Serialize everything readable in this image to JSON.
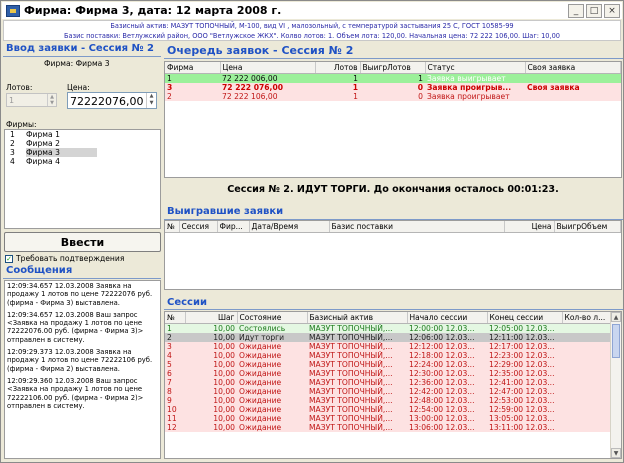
{
  "window": {
    "title": "Фирма: Фирма 3, дата: 12 марта 2008 г.",
    "minimize": "_",
    "maximize": "□",
    "close": "×"
  },
  "info": {
    "line1": "Базисный актив: МАЗУТ ТОПОЧНЫЙ, М-100, вид VI , малозольный, с температурой застывания 25 С, ГОСТ 10585-99",
    "line2": "Базис поставки: Ветлужский район, ООО \"Ветлужское ЖКХ\". Колво лотов: 1. Объем лота: 120,00. Начальная цена: 72 222 106,00. Шаг: 10,00"
  },
  "order_entry": {
    "header": "Ввод заявки - Сессия № 2",
    "firm": "Фирма: Фирма 3",
    "lots_label": "Лотов:",
    "lots_value": "1",
    "price_label": "Цена:",
    "price_value": "72222076,00",
    "firms_label": "Фирмы:",
    "firms": [
      {
        "n": "1",
        "name": "Фирма 1"
      },
      {
        "n": "2",
        "name": "Фирма 2"
      },
      {
        "n": "3",
        "name": "Фирма 3"
      },
      {
        "n": "4",
        "name": "Фирма 4"
      }
    ],
    "submit_label": "Ввести",
    "confirm_label": "Требовать подтверждения"
  },
  "messages": {
    "header": "Сообщения",
    "items": [
      "12:09:34.657 12.03.2008 Заявка на продажу 1 лотов по цене 72222076 руб. (фирма - Фирма 3) выставлена.",
      "12:09:34.657 12.03.2008 Ваш запрос <Заявка на продажу 1 лотов по цене 72222076.00 руб. (фирма - Фирма 3)> отправлен в систему.",
      "12:09:29.373 12.03.2008 Заявка на продажу 1 лотов по цене 72222106 руб. (фирма - Фирма 2) выставлена.",
      "12:09:29.360 12.03.2008 Ваш запрос <Заявка на продажу 1 лотов по цене 72222106.00 руб. (фирма - Фирма 2)> отправлен в систему."
    ]
  },
  "queue": {
    "header": "Очередь заявок - Сессия № 2",
    "columns": [
      "Фирма",
      "Цена",
      "Лотов",
      "ВыигрЛотов",
      "Статус",
      "Своя заявка"
    ],
    "rows": [
      {
        "firm": "1",
        "price": "72 222 006,00",
        "lots": "1",
        "won": "1",
        "status": "Заявка выигрывает",
        "own": ""
      },
      {
        "firm": "3",
        "price": "72 222 076,00",
        "lots": "1",
        "won": "0",
        "status": "Заявка проигрыв...",
        "own": "Своя заявка"
      },
      {
        "firm": "2",
        "price": "72 222 106,00",
        "lots": "1",
        "won": "0",
        "status": "Заявка проигрывает",
        "own": ""
      }
    ]
  },
  "session_status": "Сессия № 2. ИДУТ ТОРГИ. До окончания осталось 00:01:23.",
  "winners": {
    "header": "Выигравшие заявки",
    "columns": [
      "№",
      "Сессия",
      "Фир...",
      "Дата/Время",
      "Базис поставки",
      "Цена",
      "ВыигрОбъем"
    ]
  },
  "sessions": {
    "header": "Сессии",
    "columns": [
      "№",
      "Шаг",
      "Состояние",
      "Базисный актив",
      "Начало сессии",
      "Конец сессии",
      "Кол-во л..."
    ],
    "rows": [
      {
        "n": "1",
        "step": "10,00",
        "state": "Состоялись",
        "asset": "МАЗУТ ТОПОЧНЫЙ,...",
        "start": "12:00:00",
        "start2": "12.03...",
        "end": "12:05:00",
        "end2": "12.03..."
      },
      {
        "n": "2",
        "step": "10,00",
        "state": "Идут торги",
        "asset": "МАЗУТ ТОПОЧНЫЙ,...",
        "start": "12:06:00",
        "start2": "12.03...",
        "end": "12:11:00",
        "end2": "12.03..."
      },
      {
        "n": "3",
        "step": "10,00",
        "state": "Ожидание",
        "asset": "МАЗУТ ТОПОЧНЫЙ,...",
        "start": "12:12:00",
        "start2": "12.03...",
        "end": "12:17:00",
        "end2": "12.03..."
      },
      {
        "n": "4",
        "step": "10,00",
        "state": "Ожидание",
        "asset": "МАЗУТ ТОПОЧНЫЙ,...",
        "start": "12:18:00",
        "start2": "12.03...",
        "end": "12:23:00",
        "end2": "12.03..."
      },
      {
        "n": "5",
        "step": "10,00",
        "state": "Ожидание",
        "asset": "МАЗУТ ТОПОЧНЫЙ,...",
        "start": "12:24:00",
        "start2": "12.03...",
        "end": "12:29:00",
        "end2": "12.03..."
      },
      {
        "n": "6",
        "step": "10,00",
        "state": "Ожидание",
        "asset": "МАЗУТ ТОПОЧНЫЙ,...",
        "start": "12:30:00",
        "start2": "12.03...",
        "end": "12:35:00",
        "end2": "12.03..."
      },
      {
        "n": "7",
        "step": "10,00",
        "state": "Ожидание",
        "asset": "МАЗУТ ТОПОЧНЫЙ,...",
        "start": "12:36:00",
        "start2": "12.03...",
        "end": "12:41:00",
        "end2": "12.03..."
      },
      {
        "n": "8",
        "step": "10,00",
        "state": "Ожидание",
        "asset": "МАЗУТ ТОПОЧНЫЙ,...",
        "start": "12:42:00",
        "start2": "12.03...",
        "end": "12:47:00",
        "end2": "12.03..."
      },
      {
        "n": "9",
        "step": "10,00",
        "state": "Ожидание",
        "asset": "МАЗУТ ТОПОЧНЫЙ,...",
        "start": "12:48:00",
        "start2": "12.03...",
        "end": "12:53:00",
        "end2": "12.03..."
      },
      {
        "n": "10",
        "step": "10,00",
        "state": "Ожидание",
        "asset": "МАЗУТ ТОПОЧНЫЙ,...",
        "start": "12:54:00",
        "start2": "12.03...",
        "end": "12:59:00",
        "end2": "12.03..."
      },
      {
        "n": "11",
        "step": "10,00",
        "state": "Ожидание",
        "asset": "МАЗУТ ТОПОЧНЫЙ,...",
        "start": "13:00:00",
        "start2": "12.03...",
        "end": "13:05:00",
        "end2": "12.03..."
      },
      {
        "n": "12",
        "step": "10,00",
        "state": "Ожидание",
        "asset": "МАЗУТ ТОПОЧНЫЙ,...",
        "start": "13:06:00",
        "start2": "12.03...",
        "end": "13:11:00",
        "end2": "12.03..."
      }
    ]
  },
  "colors": {
    "header_blue": "#1f52c5",
    "win_green": "#9cf09a",
    "lose_red": "#c01616"
  }
}
